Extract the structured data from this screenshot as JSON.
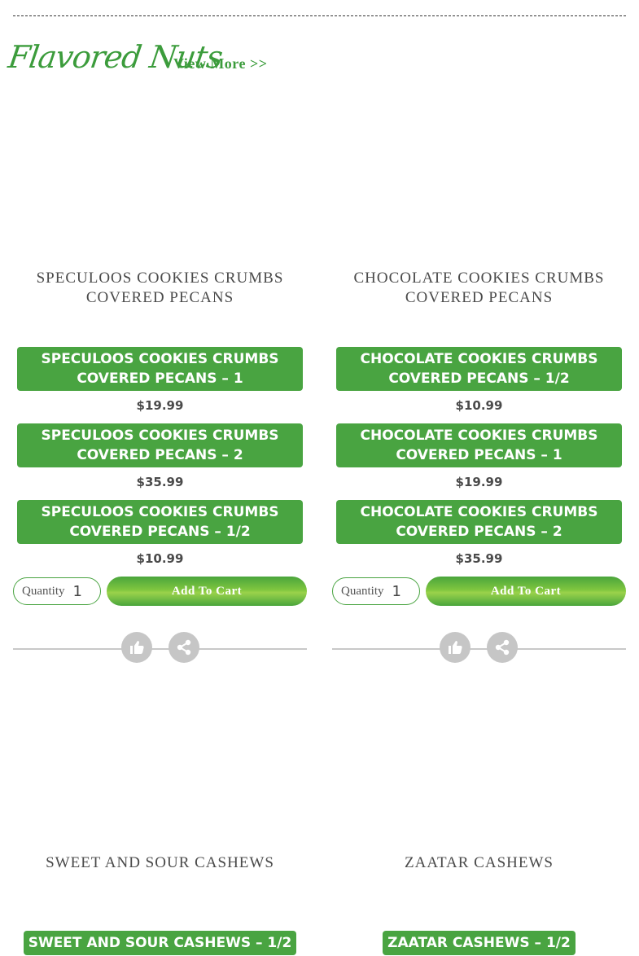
{
  "section": {
    "title": "Flavored Nuts",
    "view_more": "View More >>"
  },
  "products": [
    {
      "name_line1": "SPECULOOS COOKIES CRUMBS",
      "name_line2": "COVERED PECANS",
      "variants": [
        {
          "line1": "SPECULOOS COOKIES CRUMBS",
          "line2": "COVERED PECANS – 1",
          "price": "$19.99"
        },
        {
          "line1": "SPECULOOS COOKIES CRUMBS",
          "line2": "COVERED PECANS – 2",
          "price": "$35.99"
        },
        {
          "line1": "SPECULOOS COOKIES CRUMBS",
          "line2": "COVERED PECANS – 1/2",
          "price": "$10.99"
        }
      ],
      "quantity_label": "Quantity",
      "quantity_value": "1",
      "add_to_cart": "Add To Cart"
    },
    {
      "name_line1": "CHOCOLATE COOKIES CRUMBS",
      "name_line2": "COVERED PECANS",
      "variants": [
        {
          "line1": "CHOCOLATE COOKIES CRUMBS",
          "line2": "COVERED PECANS – 1/2",
          "price": "$10.99"
        },
        {
          "line1": "CHOCOLATE COOKIES CRUMBS",
          "line2": "COVERED PECANS – 1",
          "price": "$19.99"
        },
        {
          "line1": "CHOCOLATE COOKIES CRUMBS",
          "line2": "COVERED PECANS – 2",
          "price": "$35.99"
        }
      ],
      "quantity_label": "Quantity",
      "quantity_value": "1",
      "add_to_cart": "Add To Cart"
    },
    {
      "name": "SWEET AND SOUR CASHEWS",
      "variant": "SWEET AND SOUR CASHEWS – 1/2"
    },
    {
      "name": "ZAATAR CASHEWS",
      "variant": "ZAATAR CASHEWS – 1/2"
    }
  ],
  "icons": {
    "like": "thumbs-up-icon",
    "share": "share-icon"
  },
  "colors": {
    "brand_green": "#49a441",
    "social_grey": "#c6c6c6"
  }
}
